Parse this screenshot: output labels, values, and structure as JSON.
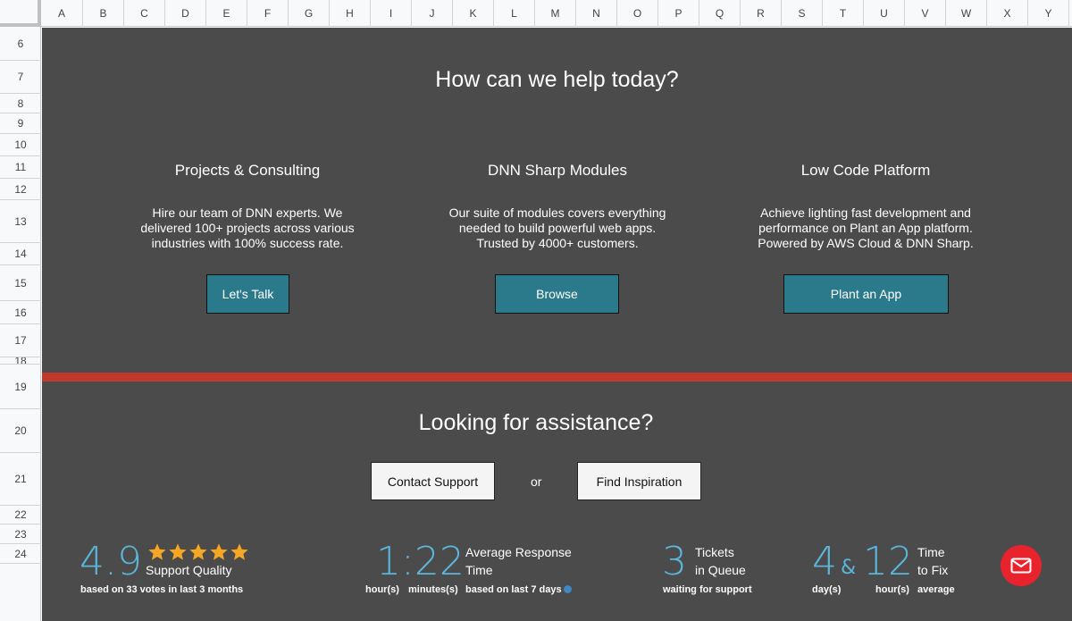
{
  "spreadsheet": {
    "columns": [
      "A",
      "B",
      "C",
      "D",
      "E",
      "F",
      "G",
      "H",
      "I",
      "J",
      "K",
      "L",
      "M",
      "N",
      "O",
      "P",
      "Q",
      "R",
      "S",
      "T",
      "U",
      "V",
      "W",
      "X",
      "Y"
    ],
    "rows": [
      "6",
      "7",
      "8",
      "9",
      "10",
      "11",
      "12",
      "13",
      "14",
      "15",
      "16",
      "17",
      "18",
      "19",
      "20",
      "21",
      "22",
      "23",
      "24"
    ]
  },
  "hero": {
    "title": "How can we help today?",
    "services": [
      {
        "title": "Projects & Consulting",
        "desc_lines": [
          "Hire our team of DNN experts. We",
          "delivered 100+ projects across various",
          "industries with 100% success rate."
        ],
        "button": "Let's Talk"
      },
      {
        "title": "DNN Sharp Modules",
        "desc_lines": [
          "Our suite of modules covers everything",
          "needed to build powerful web apps.",
          "Trusted by 4000+ customers."
        ],
        "button": "Browse"
      },
      {
        "title": "Low Code Platform",
        "desc_lines": [
          "Achieve lighting fast development and",
          "performance on Plant an App platform.",
          "Powered by AWS Cloud & DNN Sharp."
        ],
        "button": "Plant an App"
      }
    ]
  },
  "assistance": {
    "title": "Looking for assistance?",
    "contact_button": "Contact Support",
    "or_text": "or",
    "inspiration_button": "Find Inspiration"
  },
  "stats": {
    "quality": {
      "value": "4.9",
      "label": "Support Quality",
      "caption": "based on 33 votes in last 3 months",
      "stars": 5
    },
    "response": {
      "value": "1:22",
      "label_line1": "Average Response",
      "label_line2": "Time",
      "hours_label": "hour(s)",
      "minutes_label": "minutes(s)",
      "caption": "based on last 7 days"
    },
    "tickets": {
      "value": "3",
      "label_line1": "Tickets",
      "label_line2": "in Queue",
      "caption": "waiting for support"
    },
    "fix": {
      "days": "4",
      "amp": "&",
      "hours": "12",
      "label_line1": "Time",
      "label_line2": "to Fix",
      "days_label": "day(s)",
      "hours_label": "hour(s)",
      "avg_label": "average"
    }
  },
  "colors": {
    "background": "#4b4b4b",
    "accent_teal": "#2a7a8c",
    "red_bar": "#c0392b",
    "stat_blue": "#5bb6dc",
    "star_orange": "#f5a623",
    "mail_red": "#e8232d"
  },
  "icons": {
    "mail": "mail-icon",
    "star": "star-icon",
    "info": "info-icon"
  }
}
